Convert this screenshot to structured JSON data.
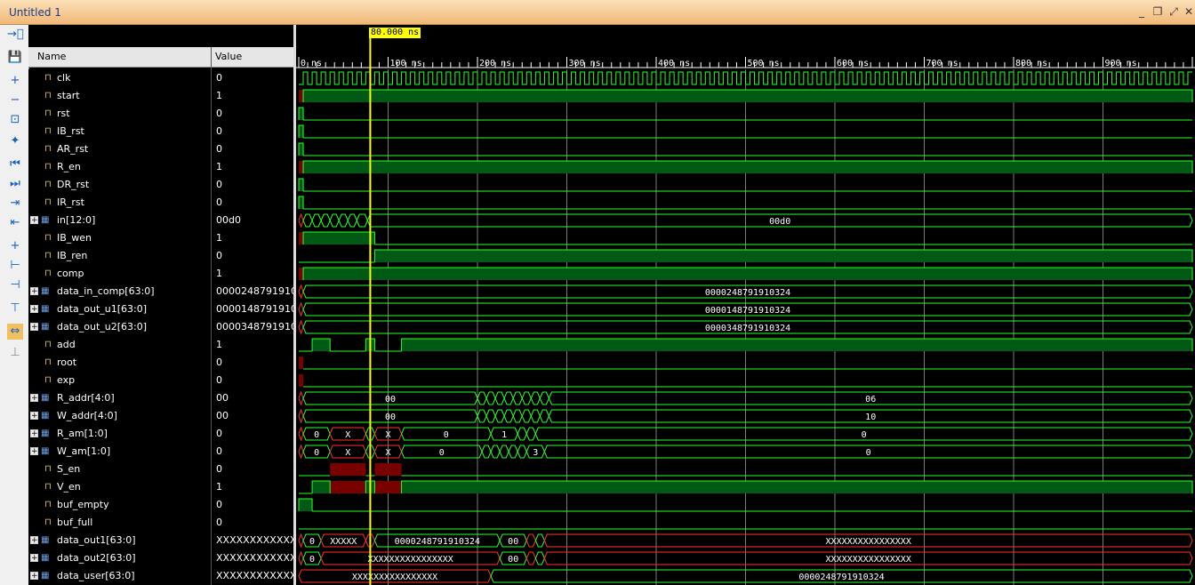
{
  "window": {
    "title": "Untitled 1",
    "minimize": "_",
    "restore": "❐",
    "maximize": "⤢",
    "close": "✕"
  },
  "toolbar": [
    "→⃒",
    "💾",
    "+",
    "−",
    "⊡",
    "✦",
    "⏮",
    "⏭",
    "⇥",
    "⇤",
    "+",
    "⊢",
    "⊣",
    "⊤",
    "⇔",
    "⊥"
  ],
  "columns": {
    "name": "Name",
    "value": "Value"
  },
  "cursor": {
    "label": "80.000 ns",
    "time_ns": 80
  },
  "timeline": {
    "range_ns": [
      0,
      1000
    ],
    "ticks": [
      "0 ns",
      "100 ns",
      "200 ns",
      "300 ns",
      "400 ns",
      "500 ns",
      "600 ns",
      "700 ns",
      "800 ns",
      "900 ns"
    ]
  },
  "signals": [
    {
      "name": "clk",
      "value": "0",
      "bus": false
    },
    {
      "name": "start",
      "value": "1",
      "bus": false
    },
    {
      "name": "rst",
      "value": "0",
      "bus": false
    },
    {
      "name": "IB_rst",
      "value": "0",
      "bus": false
    },
    {
      "name": "AR_rst",
      "value": "0",
      "bus": false
    },
    {
      "name": "R_en",
      "value": "1",
      "bus": false
    },
    {
      "name": "DR_rst",
      "value": "0",
      "bus": false
    },
    {
      "name": "IR_rst",
      "value": "0",
      "bus": false
    },
    {
      "name": "in[12:0]",
      "value": "00d0",
      "bus": true
    },
    {
      "name": "IB_wen",
      "value": "1",
      "bus": false
    },
    {
      "name": "IB_ren",
      "value": "0",
      "bus": false
    },
    {
      "name": "comp",
      "value": "1",
      "bus": false
    },
    {
      "name": "data_in_comp[63:0]",
      "value": "0000248791910324",
      "bus": true
    },
    {
      "name": "data_out_u1[63:0]",
      "value": "0000148791910324",
      "bus": true
    },
    {
      "name": "data_out_u2[63:0]",
      "value": "0000348791910324",
      "bus": true
    },
    {
      "name": "add",
      "value": "1",
      "bus": false
    },
    {
      "name": "root",
      "value": "0",
      "bus": false
    },
    {
      "name": "exp",
      "value": "0",
      "bus": false
    },
    {
      "name": "R_addr[4:0]",
      "value": "00",
      "bus": true
    },
    {
      "name": "W_addr[4:0]",
      "value": "00",
      "bus": true
    },
    {
      "name": "R_am[1:0]",
      "value": "0",
      "bus": true
    },
    {
      "name": "W_am[1:0]",
      "value": "0",
      "bus": true
    },
    {
      "name": "S_en",
      "value": "0",
      "bus": false
    },
    {
      "name": "V_en",
      "value": "1",
      "bus": false
    },
    {
      "name": "buf_empty",
      "value": "0",
      "bus": false
    },
    {
      "name": "buf_full",
      "value": "0",
      "bus": false
    },
    {
      "name": "data_out1[63:0]",
      "value": "XXXXXXXXXXXXXXXX",
      "bus": true
    },
    {
      "name": "data_out2[63:0]",
      "value": "XXXXXXXXXXXXXXXX",
      "bus": true
    },
    {
      "name": "data_user[63:0]",
      "value": "XXXXXXXXXXXXXXXX",
      "bus": true
    }
  ],
  "waves": [
    {
      "kind": "clock",
      "period_ns": 10
    },
    {
      "kind": "bit",
      "segs": [
        [
          0,
          5,
          "x"
        ],
        [
          5,
          1000,
          "1"
        ]
      ]
    },
    {
      "kind": "bit",
      "segs": [
        [
          0,
          5,
          "1"
        ],
        [
          5,
          1000,
          "0"
        ]
      ]
    },
    {
      "kind": "bit",
      "segs": [
        [
          0,
          5,
          "1"
        ],
        [
          5,
          1000,
          "0"
        ]
      ]
    },
    {
      "kind": "bit",
      "segs": [
        [
          0,
          5,
          "1"
        ],
        [
          5,
          1000,
          "0"
        ]
      ]
    },
    {
      "kind": "bit",
      "segs": [
        [
          0,
          5,
          "x"
        ],
        [
          5,
          1000,
          "1"
        ]
      ]
    },
    {
      "kind": "bit",
      "segs": [
        [
          0,
          5,
          "1"
        ],
        [
          5,
          1000,
          "0"
        ]
      ]
    },
    {
      "kind": "bit",
      "segs": [
        [
          0,
          5,
          "1"
        ],
        [
          5,
          1000,
          "0"
        ]
      ]
    },
    {
      "kind": "bus",
      "segs": [
        [
          0,
          5,
          "",
          true
        ],
        [
          5,
          15,
          ""
        ],
        [
          15,
          25,
          ""
        ],
        [
          25,
          35,
          ""
        ],
        [
          35,
          45,
          ""
        ],
        [
          45,
          55,
          ""
        ],
        [
          55,
          65,
          ""
        ],
        [
          65,
          77,
          ""
        ],
        [
          77,
          1000,
          "00d0"
        ]
      ]
    },
    {
      "kind": "bit",
      "segs": [
        [
          0,
          5,
          "x"
        ],
        [
          5,
          85,
          "1"
        ],
        [
          85,
          1000,
          "0"
        ]
      ]
    },
    {
      "kind": "bit",
      "segs": [
        [
          0,
          85,
          "0"
        ],
        [
          85,
          1000,
          "1"
        ]
      ]
    },
    {
      "kind": "bit",
      "segs": [
        [
          0,
          5,
          "x"
        ],
        [
          5,
          1000,
          "1"
        ]
      ]
    },
    {
      "kind": "bus",
      "segs": [
        [
          0,
          5,
          "",
          true
        ],
        [
          5,
          1000,
          "0000248791910324"
        ]
      ]
    },
    {
      "kind": "bus",
      "segs": [
        [
          0,
          5,
          "",
          true
        ],
        [
          5,
          1000,
          "0000148791910324"
        ]
      ]
    },
    {
      "kind": "bus",
      "segs": [
        [
          0,
          5,
          "",
          true
        ],
        [
          5,
          1000,
          "0000348791910324"
        ]
      ]
    },
    {
      "kind": "bit",
      "segs": [
        [
          0,
          15,
          "0"
        ],
        [
          15,
          35,
          "1"
        ],
        [
          35,
          75,
          "0"
        ],
        [
          75,
          85,
          "1"
        ],
        [
          85,
          115,
          "0"
        ],
        [
          115,
          1000,
          "1"
        ]
      ]
    },
    {
      "kind": "bit",
      "segs": [
        [
          0,
          5,
          "x"
        ],
        [
          5,
          1000,
          "0"
        ]
      ]
    },
    {
      "kind": "bit",
      "segs": [
        [
          0,
          5,
          "x"
        ],
        [
          5,
          1000,
          "0"
        ]
      ]
    },
    {
      "kind": "bus",
      "segs": [
        [
          0,
          5,
          "",
          true
        ],
        [
          5,
          200,
          "00"
        ],
        [
          200,
          210,
          ""
        ],
        [
          210,
          220,
          ""
        ],
        [
          220,
          230,
          ""
        ],
        [
          230,
          240,
          ""
        ],
        [
          240,
          250,
          ""
        ],
        [
          250,
          260,
          ""
        ],
        [
          260,
          270,
          ""
        ],
        [
          270,
          280,
          ""
        ],
        [
          280,
          1000,
          "06"
        ]
      ]
    },
    {
      "kind": "bus",
      "segs": [
        [
          0,
          5,
          "",
          true
        ],
        [
          5,
          200,
          "00"
        ],
        [
          200,
          210,
          ""
        ],
        [
          210,
          220,
          ""
        ],
        [
          220,
          230,
          ""
        ],
        [
          230,
          240,
          ""
        ],
        [
          240,
          250,
          ""
        ],
        [
          250,
          260,
          ""
        ],
        [
          260,
          270,
          ""
        ],
        [
          270,
          280,
          ""
        ],
        [
          280,
          1000,
          "10"
        ]
      ]
    },
    {
      "kind": "bus",
      "segs": [
        [
          0,
          5,
          "",
          true
        ],
        [
          5,
          35,
          "0"
        ],
        [
          35,
          75,
          "X",
          true
        ],
        [
          75,
          85,
          ""
        ],
        [
          85,
          115,
          "X",
          true
        ],
        [
          115,
          215,
          "0"
        ],
        [
          215,
          245,
          "1"
        ],
        [
          245,
          255,
          ""
        ],
        [
          255,
          265,
          ""
        ],
        [
          265,
          1000,
          "0"
        ]
      ]
    },
    {
      "kind": "bus",
      "segs": [
        [
          0,
          5,
          "",
          true
        ],
        [
          5,
          35,
          "0"
        ],
        [
          35,
          75,
          "X",
          true
        ],
        [
          75,
          85,
          ""
        ],
        [
          85,
          115,
          "X",
          true
        ],
        [
          115,
          205,
          "0"
        ],
        [
          205,
          215,
          ""
        ],
        [
          215,
          225,
          ""
        ],
        [
          225,
          235,
          ""
        ],
        [
          235,
          245,
          ""
        ],
        [
          245,
          255,
          ""
        ],
        [
          255,
          275,
          "3"
        ],
        [
          275,
          1000,
          "0"
        ]
      ]
    },
    {
      "kind": "bit",
      "segs": [
        [
          0,
          35,
          "0"
        ],
        [
          35,
          75,
          "x"
        ],
        [
          75,
          85,
          "0"
        ],
        [
          85,
          115,
          "x"
        ],
        [
          115,
          1000,
          "0"
        ]
      ]
    },
    {
      "kind": "bit",
      "segs": [
        [
          0,
          15,
          "0"
        ],
        [
          15,
          35,
          "1"
        ],
        [
          35,
          75,
          "x"
        ],
        [
          75,
          85,
          "1"
        ],
        [
          85,
          115,
          "x"
        ],
        [
          115,
          1000,
          "1"
        ]
      ]
    },
    {
      "kind": "bit",
      "segs": [
        [
          0,
          15,
          "1"
        ],
        [
          15,
          1000,
          "0"
        ]
      ]
    },
    {
      "kind": "bit",
      "segs": [
        [
          0,
          1000,
          "0"
        ]
      ]
    },
    {
      "kind": "bus",
      "segs": [
        [
          0,
          5,
          "",
          true
        ],
        [
          5,
          25,
          "0"
        ],
        [
          25,
          75,
          "XXXXX",
          true
        ],
        [
          75,
          85,
          "",
          true
        ],
        [
          85,
          225,
          "0000248791910324"
        ],
        [
          225,
          255,
          "00"
        ],
        [
          255,
          265,
          "",
          true
        ],
        [
          265,
          275,
          ""
        ],
        [
          275,
          1000,
          "XXXXXXXXXXXXXXXX",
          true
        ]
      ]
    },
    {
      "kind": "bus",
      "segs": [
        [
          0,
          5,
          "",
          true
        ],
        [
          5,
          25,
          "0"
        ],
        [
          25,
          225,
          "XXXXXXXXXXXXXXXX",
          true
        ],
        [
          225,
          255,
          "00"
        ],
        [
          255,
          265,
          "",
          true
        ],
        [
          265,
          275,
          ""
        ],
        [
          275,
          1000,
          "XXXXXXXXXXXXXXXX",
          true
        ]
      ]
    },
    {
      "kind": "bus",
      "segs": [
        [
          0,
          215,
          "XXXXXXXXXXXXXXXX",
          true
        ],
        [
          215,
          1000,
          "0000248791910324"
        ]
      ]
    }
  ]
}
